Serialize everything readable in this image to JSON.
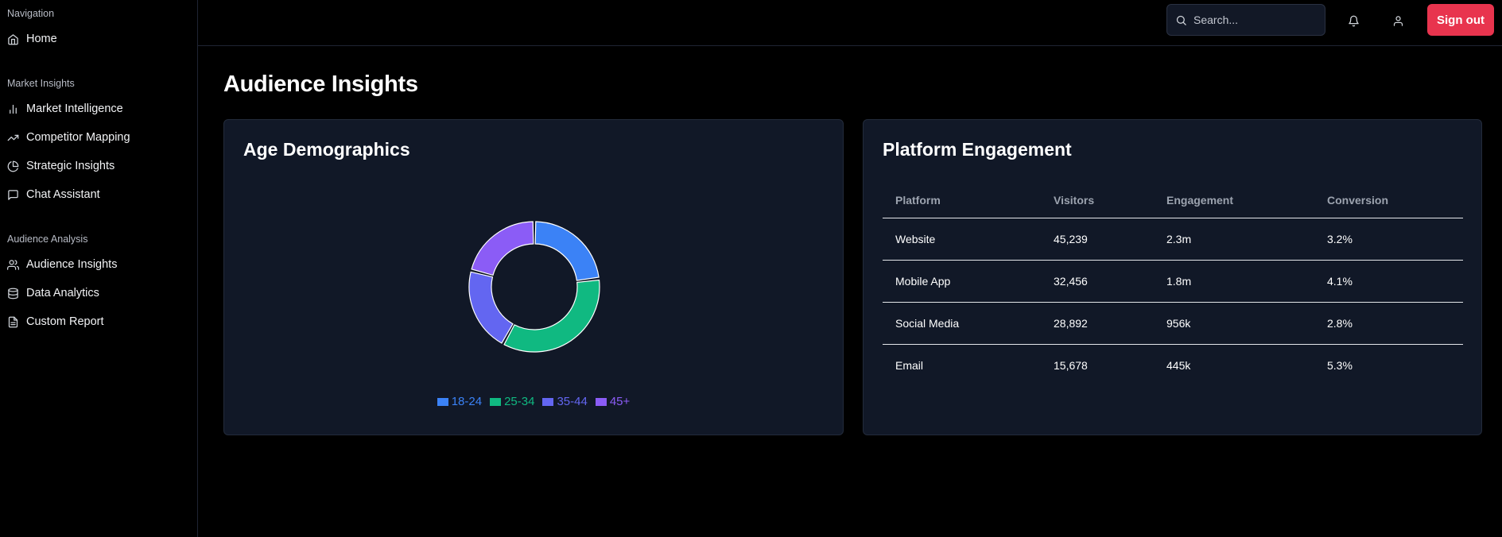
{
  "sidebar": {
    "groups": [
      {
        "title": "Navigation",
        "items": [
          {
            "label": "Home",
            "icon": "home-icon"
          }
        ]
      },
      {
        "title": "Market Insights",
        "items": [
          {
            "label": "Market Intelligence",
            "icon": "bar-chart-icon"
          },
          {
            "label": "Competitor Mapping",
            "icon": "trending-up-icon"
          },
          {
            "label": "Strategic Insights",
            "icon": "pie-chart-icon"
          },
          {
            "label": "Chat Assistant",
            "icon": "message-square-icon"
          }
        ]
      },
      {
        "title": "Audience Analysis",
        "items": [
          {
            "label": "Audience Insights",
            "icon": "users-icon"
          },
          {
            "label": "Data Analytics",
            "icon": "database-icon"
          },
          {
            "label": "Custom Report",
            "icon": "file-text-icon"
          }
        ]
      }
    ]
  },
  "topbar": {
    "search_placeholder": "Search...",
    "signout_label": "Sign out",
    "signout_color": "#e8344e"
  },
  "page": {
    "title": "Audience Insights"
  },
  "age_card": {
    "title": "Age Demographics"
  },
  "chart_data": {
    "type": "pie",
    "categories": [
      "18-24",
      "25-34",
      "35-44",
      "45+"
    ],
    "values": [
      23,
      35,
      21,
      21
    ],
    "colors": [
      "#3b82f6",
      "#10b981",
      "#6366f1",
      "#8b5cf6"
    ],
    "legend": "bottom"
  },
  "platform_card": {
    "title": "Platform Engagement",
    "columns": [
      "Platform",
      "Visitors",
      "Engagement",
      "Conversion"
    ],
    "rows": [
      [
        "Website",
        "45,239",
        "2.3m",
        "3.2%"
      ],
      [
        "Mobile App",
        "32,456",
        "1.8m",
        "4.1%"
      ],
      [
        "Social Media",
        "28,892",
        "956k",
        "2.8%"
      ],
      [
        "Email",
        "15,678",
        "445k",
        "5.3%"
      ]
    ]
  }
}
